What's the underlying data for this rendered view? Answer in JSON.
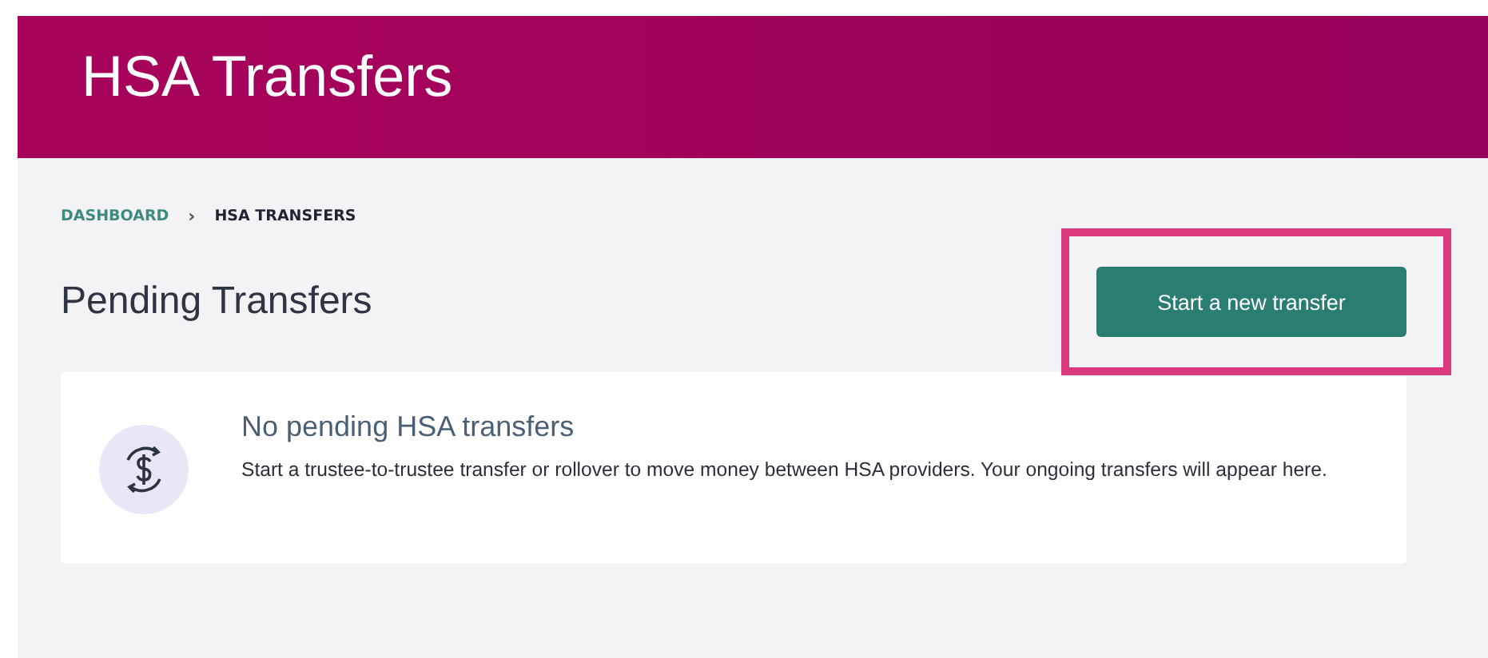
{
  "header": {
    "title": "HSA Transfers"
  },
  "breadcrumb": [
    {
      "label": "DASHBOARD",
      "current": false
    },
    {
      "label": "HSA TRANSFERS",
      "current": true
    }
  ],
  "breadcrumb_separator": "›",
  "section": {
    "title": "Pending Transfers",
    "action": {
      "label": "Start a new transfer",
      "highlighted": true
    }
  },
  "empty_state": {
    "title": "No pending HSA transfers",
    "message": "Start a trustee-to-trustee transfer or rollover to move money between HSA providers. Your ongoing transfers will appear here."
  }
}
